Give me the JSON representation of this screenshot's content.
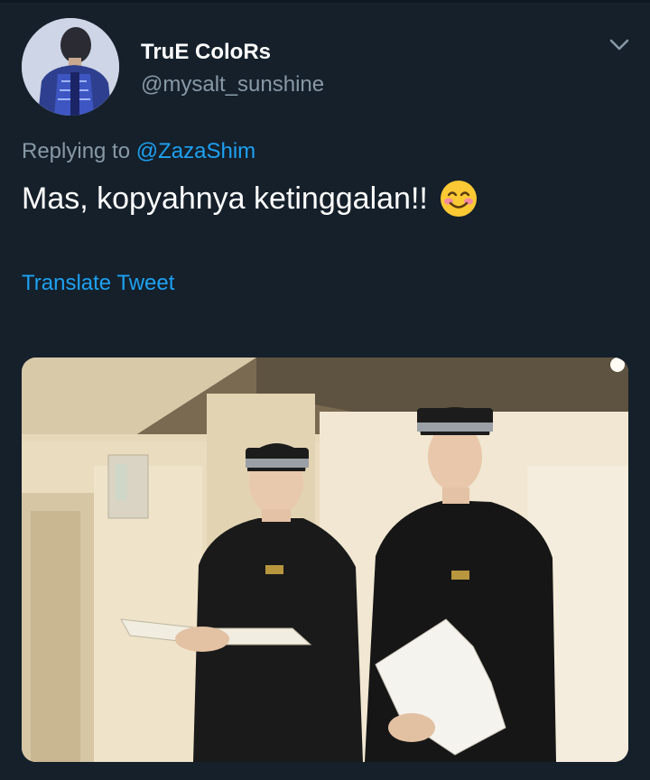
{
  "tweet": {
    "display_name": "TruE ColoRs",
    "handle": "@mysalt_sunshine",
    "replying_prefix": "Replying to",
    "replying_mention": "@ZazaShim",
    "text": "Mas, kopyahnya ketinggalan!!",
    "emoji": "smiling-face-with-smiling-eyes-emoji",
    "translate_label": "Translate Tweet"
  },
  "icons": {
    "menu": "chevron-down-icon"
  },
  "colors": {
    "background": "#15202b",
    "text_primary": "#ffffff",
    "text_secondary": "#8899a6",
    "link": "#1da1f2"
  }
}
